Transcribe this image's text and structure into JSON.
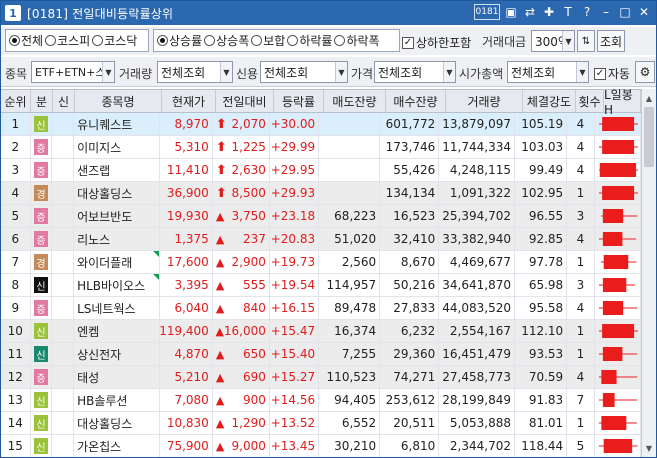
{
  "window": {
    "screen_no": "[0181]",
    "title": "전일대비등락률상위",
    "number_icon": "1",
    "title_icons": [
      "window-list-icon",
      "link-icon",
      "pin-icon",
      "font-size-icon",
      "help-icon",
      "minimize-icon",
      "maximize-icon",
      "close-icon"
    ],
    "title_glyphs": [
      "0181",
      "▣",
      "⇄",
      "✚",
      "T",
      "?",
      "–",
      "□",
      "✕"
    ]
  },
  "filters": {
    "market": {
      "options": [
        "전체",
        "코스피",
        "코스닥"
      ],
      "selected": 0
    },
    "type": {
      "options": [
        "상승률",
        "상승폭",
        "보합",
        "하락률",
        "하락폭"
      ],
      "selected": 0
    },
    "limit_include": {
      "label": "상하한포함",
      "checked": true
    },
    "volume_label": "거래대금",
    "volume_value": "300억",
    "search_button": "조회",
    "item_label": "종목",
    "item_value": "ETF+ETN+스|",
    "trade_label": "거래량",
    "trade_value": "전체조회",
    "credit_label": "신용",
    "credit_value": "전체조회",
    "price_label": "가격",
    "price_value": "전체조회",
    "mcap_label": "시가총액",
    "mcap_value": "전체조회",
    "auto_label": "자동",
    "auto_checked": true
  },
  "columns": [
    "순위",
    "분",
    "신",
    "종목명",
    "현재가",
    "전일대비",
    "등락률",
    "매도잔량",
    "매수잔량",
    "거래량",
    "체결강도",
    "횟수",
    "L일봉H"
  ],
  "colors": {
    "marker_green": "#9bc23a",
    "marker_pink": "#e07aa0",
    "marker_black": "#111111",
    "marker_teal": "#1a8a6e",
    "marker_tan": "#c48a5a",
    "up_red": "#e01c1c",
    "bar_red": "#ea1c1c",
    "selection": "#dbeefb",
    "row_gray": "#ececec"
  },
  "rows": [
    {
      "rank": "1",
      "mark": "신",
      "mcolor": "#9bc23a",
      "name": "유니퀘스트",
      "price": "8,970",
      "arrow": "bold",
      "chg": "2,070",
      "rate": "+30.00",
      "sell": "",
      "buy": "601,772",
      "vol": "13,879,097",
      "str": "105.19",
      "cnt": "4",
      "flag": false,
      "sel": true,
      "gray": false,
      "bar": [
        0.08,
        0.9,
        0.0,
        1.0
      ]
    },
    {
      "rank": "2",
      "mark": "증",
      "mcolor": "#e07aa0",
      "name": "이미지스",
      "price": "5,310",
      "arrow": "bold",
      "chg": "1,225",
      "rate": "+29.99",
      "sell": "",
      "buy": "173,746",
      "vol": "11,744,334",
      "str": "103.03",
      "cnt": "4",
      "flag": false,
      "sel": false,
      "gray": false,
      "bar": [
        0.08,
        0.9,
        0.0,
        1.0
      ]
    },
    {
      "rank": "3",
      "mark": "증",
      "mcolor": "#e07aa0",
      "name": "샌즈랩",
      "price": "11,410",
      "arrow": "bold",
      "chg": "2,630",
      "rate": "+29.95",
      "sell": "",
      "buy": "55,426",
      "vol": "4,248,115",
      "str": "99.49",
      "cnt": "4",
      "flag": false,
      "sel": false,
      "gray": false,
      "bar": [
        0.02,
        0.95,
        0.0,
        1.0
      ]
    },
    {
      "rank": "4",
      "mark": "경",
      "mcolor": "#c48a5a",
      "name": "대상홀딩스",
      "price": "36,900",
      "arrow": "bold",
      "chg": "8,500",
      "rate": "+29.93",
      "sell": "",
      "buy": "134,134",
      "vol": "1,091,322",
      "str": "102.95",
      "cnt": "1",
      "flag": false,
      "sel": false,
      "gray": true,
      "bar": [
        0.08,
        0.9,
        0.0,
        1.0
      ]
    },
    {
      "rank": "5",
      "mark": "증",
      "mcolor": "#e07aa0",
      "name": "어보브반도",
      "price": "19,930",
      "arrow": "tri",
      "chg": "3,750",
      "rate": "+23.18",
      "sell": "68,223",
      "buy": "16,523",
      "vol": "25,394,702",
      "str": "96.55",
      "cnt": "3",
      "flag": false,
      "sel": false,
      "gray": true,
      "bar": [
        0.1,
        0.62,
        0.05,
        0.98
      ]
    },
    {
      "rank": "6",
      "mark": "증",
      "mcolor": "#e07aa0",
      "name": "리노스",
      "price": "1,375",
      "arrow": "tri",
      "chg": "237",
      "rate": "+20.83",
      "sell": "51,020",
      "buy": "32,410",
      "vol": "33,382,940",
      "str": "92.85",
      "cnt": "4",
      "flag": false,
      "sel": false,
      "gray": true,
      "bar": [
        0.1,
        0.6,
        0.0,
        0.95
      ]
    },
    {
      "rank": "7",
      "mark": "경",
      "mcolor": "#c48a5a",
      "name": "와이더플래",
      "price": "17,600",
      "arrow": "tri",
      "chg": "2,900",
      "rate": "+19.73",
      "sell": "2,560",
      "buy": "8,670",
      "vol": "4,469,677",
      "str": "97.78",
      "cnt": "1",
      "flag": true,
      "sel": false,
      "gray": false,
      "bar": [
        0.12,
        0.75,
        0.05,
        0.96
      ]
    },
    {
      "rank": "8",
      "mark": "신",
      "mcolor": "#111111",
      "name": "HLB바이오스",
      "price": "3,395",
      "arrow": "tri",
      "chg": "555",
      "rate": "+19.54",
      "sell": "114,957",
      "buy": "50,216",
      "vol": "34,641,870",
      "str": "65.98",
      "cnt": "3",
      "flag": true,
      "sel": false,
      "gray": false,
      "bar": [
        0.1,
        0.7,
        0.0,
        0.92
      ]
    },
    {
      "rank": "9",
      "mark": "증",
      "mcolor": "#e07aa0",
      "name": "LS네트웍스",
      "price": "6,040",
      "arrow": "tri",
      "chg": "840",
      "rate": "+16.15",
      "sell": "89,478",
      "buy": "27,833",
      "vol": "44,083,520",
      "str": "95.58",
      "cnt": "4",
      "flag": false,
      "sel": false,
      "gray": false,
      "bar": [
        0.1,
        0.62,
        0.0,
        0.98
      ]
    },
    {
      "rank": "10",
      "mark": "신",
      "mcolor": "#9bc23a",
      "name": "엔켐",
      "price": "119,400",
      "arrow": "tri",
      "chg": "16,000",
      "rate": "+15.47",
      "sell": "16,374",
      "buy": "6,232",
      "vol": "2,554,167",
      "str": "112.10",
      "cnt": "1",
      "flag": false,
      "sel": false,
      "gray": true,
      "bar": [
        0.08,
        0.9,
        0.0,
        1.0
      ]
    },
    {
      "rank": "11",
      "mark": "신",
      "mcolor": "#1a8a6e",
      "name": "상신전자",
      "price": "4,870",
      "arrow": "tri",
      "chg": "650",
      "rate": "+15.40",
      "sell": "7,255",
      "buy": "29,360",
      "vol": "16,451,479",
      "str": "93.53",
      "cnt": "1",
      "flag": false,
      "sel": false,
      "gray": true,
      "bar": [
        0.1,
        0.6,
        0.0,
        0.98
      ]
    },
    {
      "rank": "12",
      "mark": "증",
      "mcolor": "#e07aa0",
      "name": "태성",
      "price": "5,210",
      "arrow": "tri",
      "chg": "690",
      "rate": "+15.27",
      "sell": "110,523",
      "buy": "74,271",
      "vol": "27,458,773",
      "str": "70.59",
      "cnt": "4",
      "flag": false,
      "sel": false,
      "gray": true,
      "bar": [
        0.06,
        0.45,
        0.0,
        0.98
      ]
    },
    {
      "rank": "13",
      "mark": "신",
      "mcolor": "#9bc23a",
      "name": "HB솔루션",
      "price": "7,080",
      "arrow": "tri",
      "chg": "900",
      "rate": "+14.56",
      "sell": "94,405",
      "buy": "253,612",
      "vol": "28,199,849",
      "str": "91.83",
      "cnt": "7",
      "flag": false,
      "sel": false,
      "gray": false,
      "bar": [
        0.1,
        0.4,
        0.0,
        0.98
      ]
    },
    {
      "rank": "14",
      "mark": "신",
      "mcolor": "#9bc23a",
      "name": "대상홀딩스",
      "price": "10,830",
      "arrow": "tri",
      "chg": "1,290",
      "rate": "+13.52",
      "sell": "6,552",
      "buy": "20,511",
      "vol": "5,053,888",
      "str": "81.01",
      "cnt": "1",
      "flag": false,
      "sel": false,
      "gray": false,
      "bar": [
        0.06,
        0.7,
        0.0,
        0.97
      ]
    },
    {
      "rank": "15",
      "mark": "신",
      "mcolor": "#9bc23a",
      "name": "가온칩스",
      "price": "75,900",
      "arrow": "tri",
      "chg": "9,000",
      "rate": "+13.45",
      "sell": "30,210",
      "buy": "6,810",
      "vol": "2,344,702",
      "str": "118.44",
      "cnt": "5",
      "flag": false,
      "sel": false,
      "gray": false,
      "bar": [
        0.12,
        0.85,
        0.0,
        0.99
      ]
    }
  ]
}
